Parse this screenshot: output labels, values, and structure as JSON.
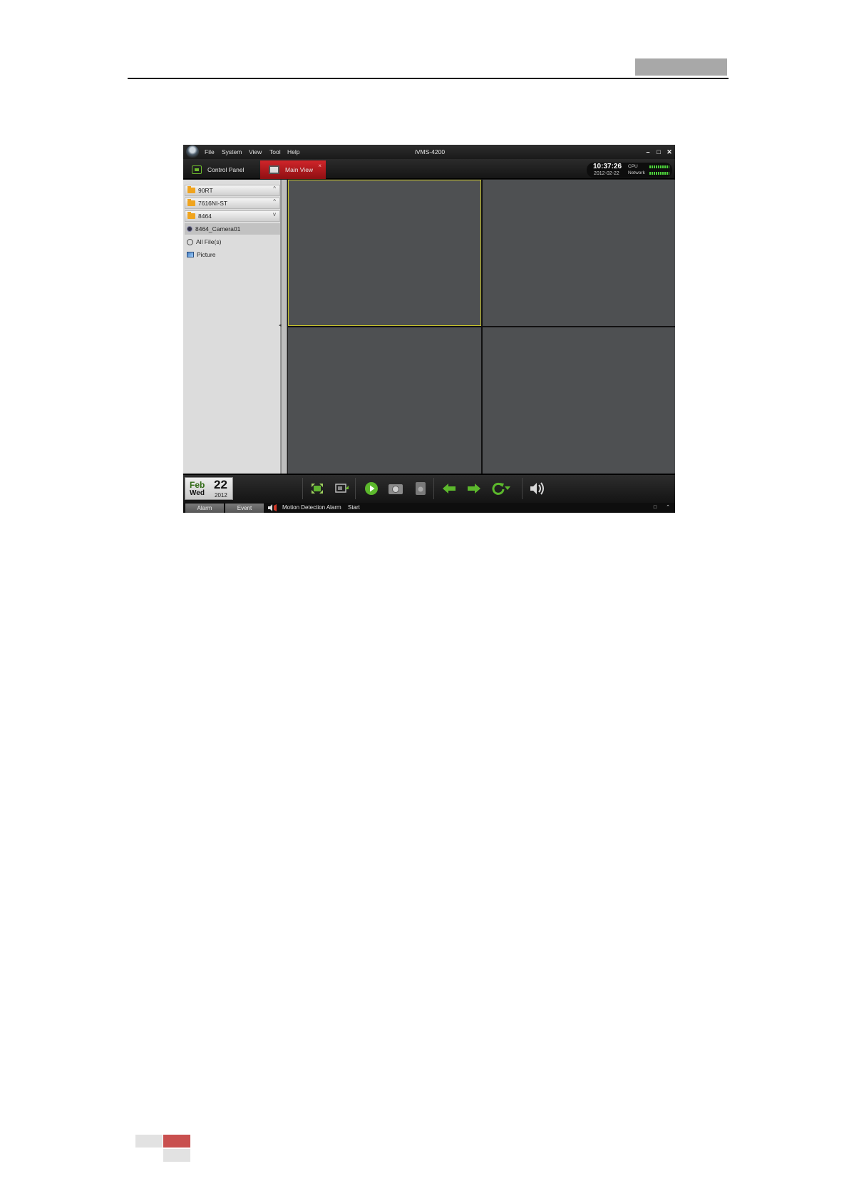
{
  "window": {
    "title": "iVMS-4200",
    "controls": [
      "–",
      "□",
      "✕"
    ]
  },
  "menu": {
    "items": [
      "File",
      "System",
      "View",
      "Tool",
      "Help"
    ]
  },
  "tabs": {
    "control_panel": "Control Panel",
    "main_view": "Main View",
    "close": "×"
  },
  "status": {
    "time": "10:37:26",
    "date": "2012-02-22",
    "cpu_label": "CPU",
    "network_label": "Network"
  },
  "sidebar": {
    "groups": [
      {
        "label": "90RT",
        "arrow": "^"
      },
      {
        "label": "7616NI-ST",
        "arrow": "^"
      },
      {
        "label": "8464",
        "arrow": "v"
      }
    ],
    "items": [
      {
        "label": "8464_Camera01"
      },
      {
        "label": "All File(s)"
      },
      {
        "label": "Picture"
      }
    ]
  },
  "calendar": {
    "month": "Feb",
    "weekday": "Wed",
    "day": "22",
    "year": "2012"
  },
  "toolbar": {
    "icons": [
      "fullscreen-icon",
      "window-layout-icon",
      "play-icon",
      "capture-icon",
      "record-icon",
      "previous-icon",
      "next-icon",
      "refresh-icon",
      "dropdown-icon",
      "volume-icon"
    ]
  },
  "statusbar": {
    "alarm_tab": "Alarm",
    "event_tab": "Event",
    "message": "Motion Detection Alarm",
    "state": "Start"
  },
  "colors": {
    "accent_red": "#c81e24",
    "accent_green": "#6dbb2d",
    "selected_border": "#c6c22c"
  }
}
